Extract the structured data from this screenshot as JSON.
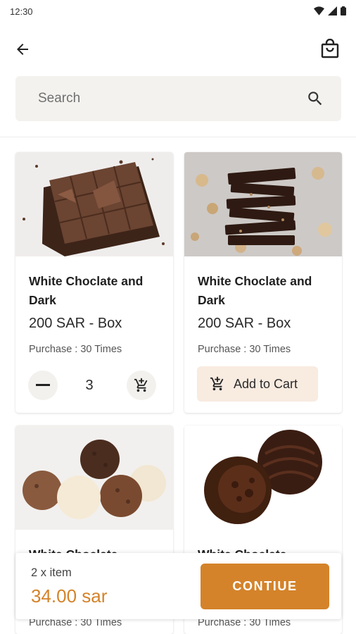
{
  "status_bar": {
    "time": "12:30"
  },
  "search": {
    "placeholder": "Search"
  },
  "products": [
    {
      "title": "White Choclate and Dark",
      "price": "200 SAR - Box",
      "purchase": "Purchase : 30 Times",
      "quantity": "3",
      "image": "chocolate-bar-broken"
    },
    {
      "title": "White Choclate and Dark",
      "price": "200 SAR - Box",
      "purchase": "Purchase : 30 Times",
      "add_to_cart": "Add to Cart",
      "image": "chocolate-stack"
    },
    {
      "title": "White Choclate",
      "purchase": "Purchase : 30 Times",
      "image": "truffles-mix"
    },
    {
      "title": "White Choclate",
      "purchase": "Purchase : 30 Times",
      "image": "dark-truffles"
    }
  ],
  "checkout": {
    "count": "2 x item",
    "total": "34.00 sar",
    "button": "CONTIUE"
  },
  "colors": {
    "accent": "#d4832a",
    "add_cart_bg": "#f8ebe0",
    "search_bg": "#f3f2ef"
  }
}
